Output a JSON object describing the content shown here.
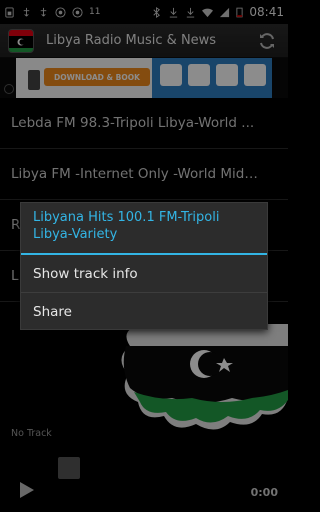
{
  "status_bar": {
    "battery_percent": "11",
    "time": "08:41",
    "left_icons": [
      "sim-icon",
      "usb-icon",
      "usb-icon",
      "whatsapp-icon",
      "whatsapp-icon"
    ],
    "right_icons": [
      "bluetooth-icon",
      "download-icon",
      "download-icon",
      "wifi-icon",
      "signal-icon",
      "battery-icon"
    ]
  },
  "action_bar": {
    "title": "Libya Radio Music & News",
    "app_icon": "libya-flag-icon",
    "refresh_icon": "refresh-icon"
  },
  "ad": {
    "button_label": "DOWNLOAD & BOOK"
  },
  "list": {
    "items": [
      "Lebda FM 98.3-Tripoli Libya-World ...",
      "Libya FM -Internet Only -World Middl...",
      "R",
      "L"
    ]
  },
  "dialog": {
    "title": "Libyana Hits 100.1 FM-Tripoli Libya-Variety",
    "items": [
      "Show track info",
      "Share"
    ]
  },
  "player": {
    "track": "No Track",
    "time": "0:00"
  },
  "colors": {
    "accent": "#33b5e5",
    "flag_red": "#e70013",
    "flag_green": "#239e46"
  }
}
